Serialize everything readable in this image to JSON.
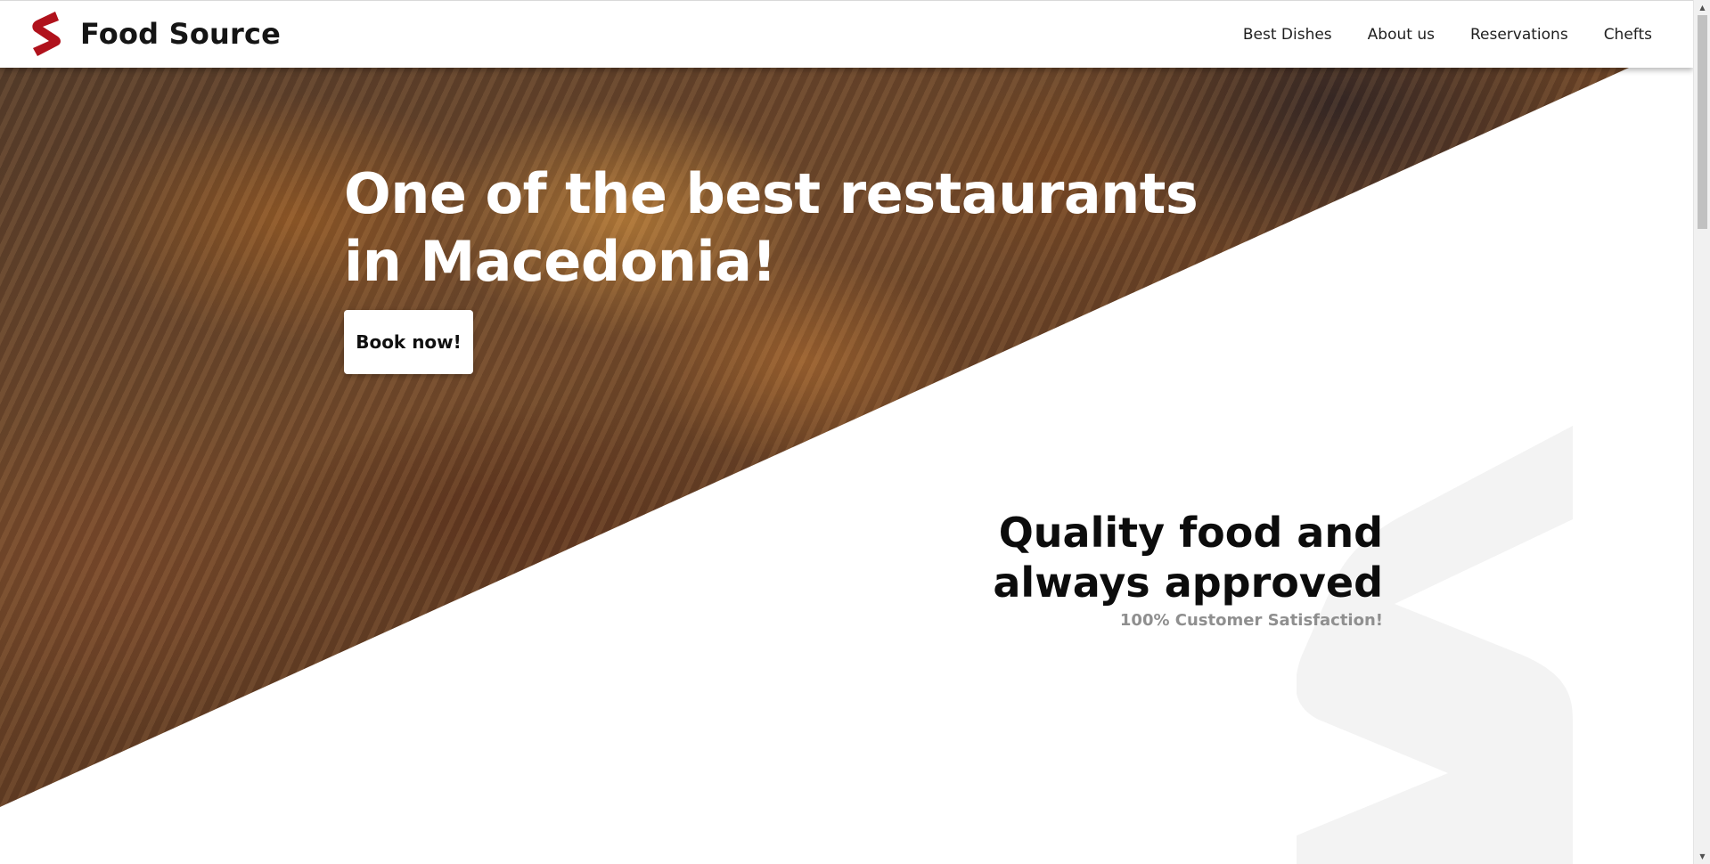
{
  "brand": {
    "name": "Food Source",
    "logo_icon": "s-logo-icon",
    "logo_color": "#b0121c"
  },
  "nav": {
    "items": [
      {
        "label": "Best Dishes"
      },
      {
        "label": "About us"
      },
      {
        "label": "Reservations"
      },
      {
        "label": "Chefts"
      }
    ]
  },
  "hero": {
    "title": "One of the best restaurants in Macedonia!",
    "button_label": "Book now!"
  },
  "quality": {
    "title_line1": "Quality food and",
    "title_line2": "always approved",
    "subtitle": "100% Customer Satisfaction!"
  },
  "colors": {
    "accent": "#b0121c",
    "watermark": "#f3f3f3",
    "subtitle_gray": "#8f8f8f"
  }
}
